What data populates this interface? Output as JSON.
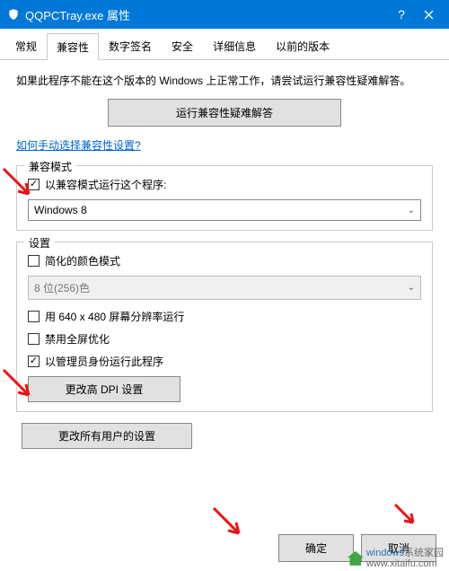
{
  "titlebar": {
    "title": "QQPCTray.exe 属性"
  },
  "tabs": [
    "常规",
    "兼容性",
    "数字签名",
    "安全",
    "详细信息",
    "以前的版本"
  ],
  "active_tab_index": 1,
  "intro": "如果此程序不能在这个版本的 Windows 上正常工作，请尝试运行兼容性疑难解答。",
  "troubleshoot_btn": "运行兼容性疑难解答",
  "help_link": "如何手动选择兼容性设置?",
  "compat_group": {
    "label": "兼容模式",
    "checkbox_label": "以兼容模式运行这个程序:",
    "checkbox_checked": true,
    "select_value": "Windows 8"
  },
  "settings_group": {
    "label": "设置",
    "color_mode_label": "简化的颜色模式",
    "color_mode_checked": false,
    "color_select_value": "8 位(256)色",
    "res_label": "用 640 x 480 屏幕分辨率运行",
    "res_checked": false,
    "fullscreen_label": "禁用全屏优化",
    "fullscreen_checked": false,
    "admin_label": "以管理员身份运行此程序",
    "admin_checked": true,
    "dpi_btn": "更改高 DPI 设置"
  },
  "all_users_btn": "更改所有用户的设置",
  "footer": {
    "ok": "确定",
    "cancel": "取消"
  },
  "watermark": {
    "brand": "windows",
    "site": "系统家园",
    "url": "www.xitaifu.com"
  }
}
